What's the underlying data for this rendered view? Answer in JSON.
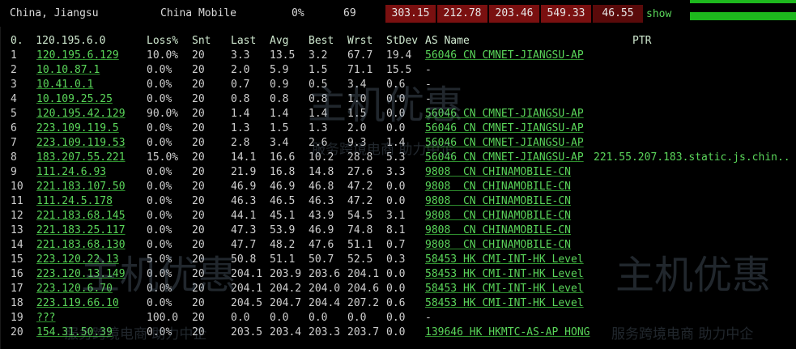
{
  "topbar": {
    "location": "China, Jiangsu",
    "isp": "China Mobile",
    "loss": "0%",
    "sent": "69",
    "metrics": [
      "303.15",
      "212.78",
      "203.46",
      "549.33",
      "46.55"
    ],
    "show_link": "show",
    "colors": {
      "metric_bg": "#7a1010",
      "metric_bg_dark": "#5a0a0a",
      "bar": "#1db81d"
    }
  },
  "mtr": {
    "headers": {
      "ip": "0.  120.195.6.0",
      "loss": "Loss%",
      "snt": "Snt",
      "last": "Last",
      "avg": "Avg",
      "best": "Best",
      "wrst": "Wrst",
      "stdev": "StDev",
      "asname": "AS Name",
      "ptr": "PTR"
    },
    "rows": [
      {
        "hop": "1",
        "ip": "120.195.6.129",
        "loss": "10.0%",
        "snt": "20",
        "last": "3.3",
        "avg": "13.5",
        "best": "3.2",
        "wrst": "67.7",
        "stdev": "19.4",
        "as": "56046 CN CMNET-JIANGSU-AP",
        "ptr": ""
      },
      {
        "hop": "2",
        "ip": "10.10.87.1",
        "loss": "0.0%",
        "snt": "20",
        "last": "2.0",
        "avg": "5.9",
        "best": "1.5",
        "wrst": "71.1",
        "stdev": "15.5",
        "as": "-",
        "ptr": ""
      },
      {
        "hop": "3",
        "ip": "10.41.0.1",
        "loss": "0.0%",
        "snt": "20",
        "last": "0.7",
        "avg": "0.9",
        "best": "0.5",
        "wrst": "3.4",
        "stdev": "0.6",
        "as": "-",
        "ptr": ""
      },
      {
        "hop": "4",
        "ip": "10.109.25.25",
        "loss": "0.0%",
        "snt": "20",
        "last": "0.8",
        "avg": "0.8",
        "best": "0.8",
        "wrst": "1.0",
        "stdev": "0.0",
        "as": "-",
        "ptr": ""
      },
      {
        "hop": "5",
        "ip": "120.195.42.129",
        "loss": "90.0%",
        "snt": "20",
        "last": "1.4",
        "avg": "1.4",
        "best": "1.4",
        "wrst": "1.5",
        "stdev": "0.0",
        "as": "56046 CN CMNET-JIANGSU-AP",
        "ptr": ""
      },
      {
        "hop": "6",
        "ip": "223.109.119.5",
        "loss": "0.0%",
        "snt": "20",
        "last": "1.3",
        "avg": "1.5",
        "best": "1.3",
        "wrst": "2.0",
        "stdev": "0.0",
        "as": "56046 CN CMNET-JIANGSU-AP",
        "ptr": ""
      },
      {
        "hop": "7",
        "ip": "223.109.119.53",
        "loss": "0.0%",
        "snt": "20",
        "last": "2.8",
        "avg": "3.4",
        "best": "2.6",
        "wrst": "9.3",
        "stdev": "1.4",
        "as": "56046 CN CMNET-JIANGSU-AP",
        "ptr": ""
      },
      {
        "hop": "8",
        "ip": "183.207.55.221",
        "loss": "15.0%",
        "snt": "20",
        "last": "14.1",
        "avg": "16.6",
        "best": "10.2",
        "wrst": "28.8",
        "stdev": "5.3",
        "as": "56046 CN CMNET-JIANGSU-AP",
        "ptr": "221.55.207.183.static.js.chin.."
      },
      {
        "hop": "9",
        "ip": "111.24.6.93",
        "loss": "0.0%",
        "snt": "20",
        "last": "21.9",
        "avg": "16.8",
        "best": "14.8",
        "wrst": "27.6",
        "stdev": "3.3",
        "as": "9808  CN CHINAMOBILE-CN",
        "ptr": ""
      },
      {
        "hop": "10",
        "ip": "221.183.107.50",
        "loss": "0.0%",
        "snt": "20",
        "last": "46.9",
        "avg": "46.9",
        "best": "46.8",
        "wrst": "47.2",
        "stdev": "0.0",
        "as": "9808  CN CHINAMOBILE-CN",
        "ptr": ""
      },
      {
        "hop": "11",
        "ip": "111.24.5.178",
        "loss": "0.0%",
        "snt": "20",
        "last": "46.3",
        "avg": "46.5",
        "best": "46.3",
        "wrst": "47.2",
        "stdev": "0.0",
        "as": "9808  CN CHINAMOBILE-CN",
        "ptr": ""
      },
      {
        "hop": "12",
        "ip": "221.183.68.145",
        "loss": "0.0%",
        "snt": "20",
        "last": "44.1",
        "avg": "45.1",
        "best": "43.9",
        "wrst": "54.5",
        "stdev": "3.1",
        "as": "9808  CN CHINAMOBILE-CN",
        "ptr": ""
      },
      {
        "hop": "13",
        "ip": "221.183.25.117",
        "loss": "0.0%",
        "snt": "20",
        "last": "47.3",
        "avg": "53.9",
        "best": "46.9",
        "wrst": "74.8",
        "stdev": "8.1",
        "as": "9808  CN CHINAMOBILE-CN",
        "ptr": ""
      },
      {
        "hop": "14",
        "ip": "221.183.68.130",
        "loss": "0.0%",
        "snt": "20",
        "last": "47.7",
        "avg": "48.2",
        "best": "47.6",
        "wrst": "51.1",
        "stdev": "0.7",
        "as": "9808  CN CHINAMOBILE-CN",
        "ptr": ""
      },
      {
        "hop": "15",
        "ip": "223.120.22.13",
        "loss": "5.0%",
        "snt": "20",
        "last": "50.8",
        "avg": "51.1",
        "best": "50.7",
        "wrst": "52.5",
        "stdev": "0.3",
        "as": "58453 HK CMI-INT-HK Level",
        "ptr": ""
      },
      {
        "hop": "16",
        "ip": "223.120.13.149",
        "loss": "0.0%",
        "snt": "20",
        "last": "204.1",
        "avg": "203.9",
        "best": "203.6",
        "wrst": "204.1",
        "stdev": "0.0",
        "as": "58453 HK CMI-INT-HK Level",
        "ptr": ""
      },
      {
        "hop": "17",
        "ip": "223.120.6.70",
        "loss": "0.0%",
        "snt": "20",
        "last": "204.1",
        "avg": "204.2",
        "best": "204.0",
        "wrst": "204.6",
        "stdev": "0.0",
        "as": "58453 HK CMI-INT-HK Level",
        "ptr": ""
      },
      {
        "hop": "18",
        "ip": "223.119.66.10",
        "loss": "0.0%",
        "snt": "20",
        "last": "204.5",
        "avg": "204.7",
        "best": "204.4",
        "wrst": "207.2",
        "stdev": "0.6",
        "as": "58453 HK CMI-INT-HK Level",
        "ptr": ""
      },
      {
        "hop": "19",
        "ip": "???",
        "loss": "100.0",
        "snt": "20",
        "last": "0.0",
        "avg": "0.0",
        "best": "0.0",
        "wrst": "0.0",
        "stdev": "0.0",
        "as": "-",
        "ptr": ""
      },
      {
        "hop": "20",
        "ip": "154.31.50.39",
        "loss": "0.0%",
        "snt": "20",
        "last": "203.5",
        "avg": "203.4",
        "best": "203.3",
        "wrst": "203.7",
        "stdev": "0.0",
        "as": "139646 HK HKMTC-AS-AP HONG",
        "ptr": ""
      }
    ]
  },
  "watermark": {
    "brand": "主机优惠",
    "slogan": "服务跨境电商 助力中企"
  }
}
